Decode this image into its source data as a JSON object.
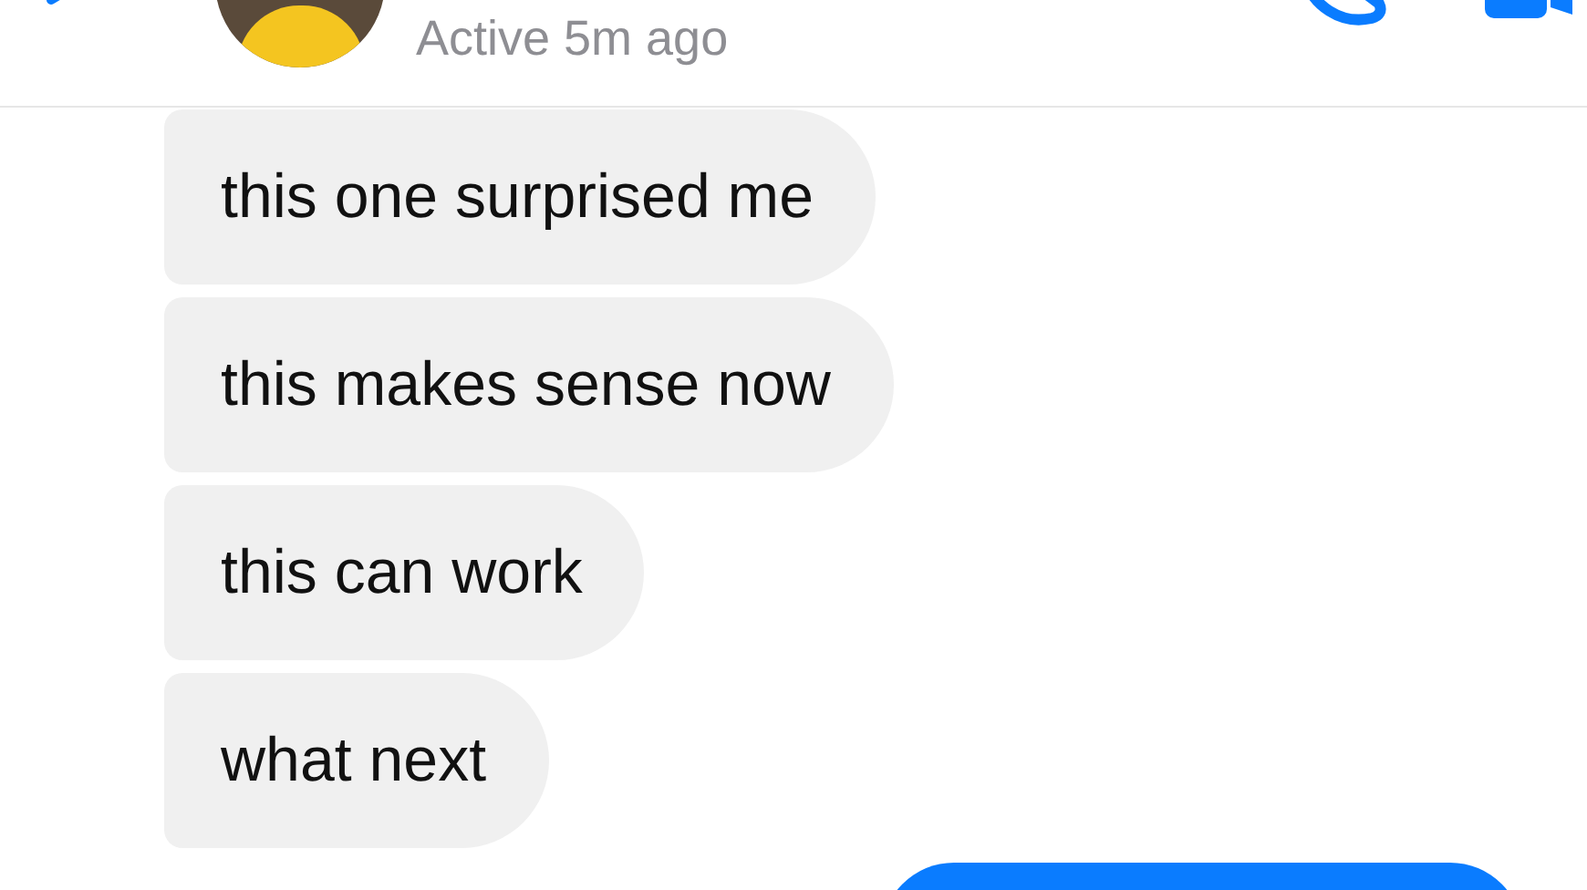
{
  "header": {
    "status": "Active 5m ago"
  },
  "messages": [
    {
      "text": "this one surprised me",
      "kind": "received"
    },
    {
      "text": "this makes sense now",
      "kind": "received"
    },
    {
      "text": "this can work",
      "kind": "received"
    },
    {
      "text": "what next",
      "kind": "received"
    }
  ]
}
